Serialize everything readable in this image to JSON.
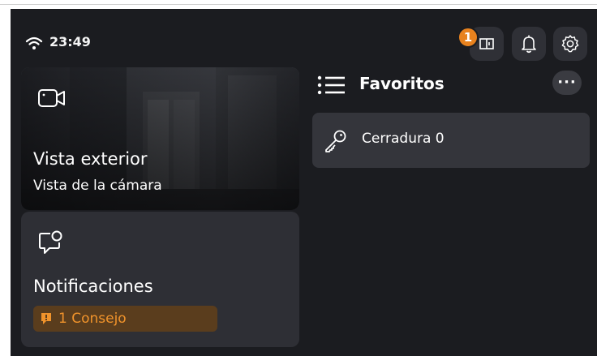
{
  "status": {
    "time": "23:49",
    "door_badge_count": "1"
  },
  "cards": {
    "camera": {
      "title": "Vista exterior",
      "subtitle": "Vista de la cámara",
      "icon": "video-camera-icon"
    },
    "notifications": {
      "title": "Notificaciones",
      "tip_label": "1 Consejo",
      "icon": "message-bubble-icon"
    }
  },
  "favorites": {
    "title": "Favoritos",
    "more_label": "···",
    "items": [
      {
        "label": "Cerradura 0",
        "icon": "key-icon"
      }
    ]
  },
  "colors": {
    "background": "#1b1c20",
    "card": "#2e2f35",
    "accent": "#e8821e",
    "tip_background": "#5a3d1d",
    "tip_text": "#f0932b"
  }
}
